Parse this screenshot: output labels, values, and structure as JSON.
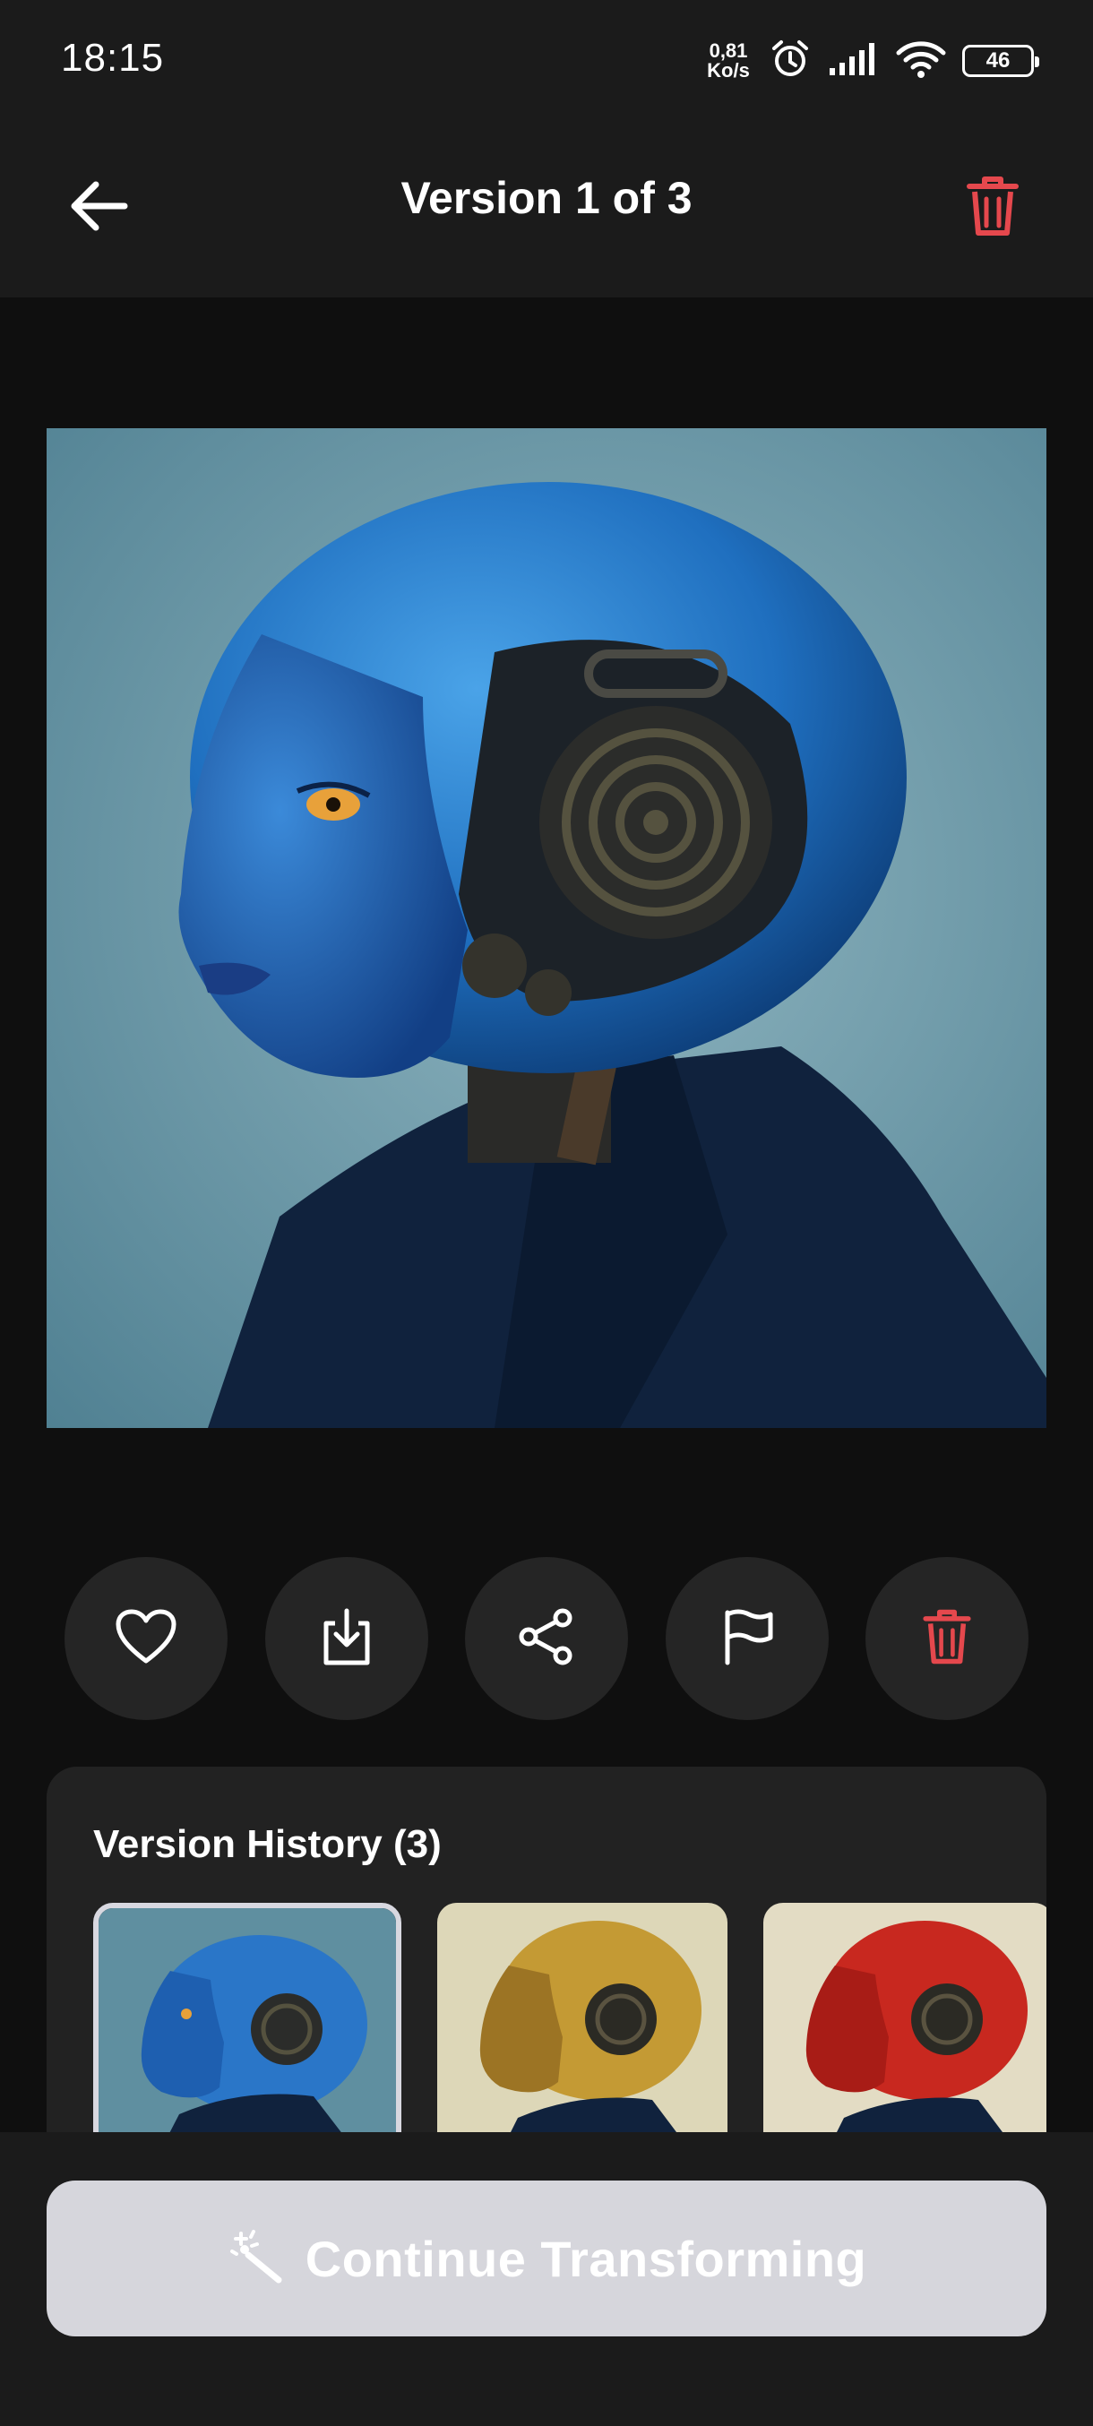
{
  "status_bar": {
    "time": "18:15",
    "net_speed_value": "0,81",
    "net_speed_unit": "Ko/s",
    "battery": "46",
    "icons": [
      "alarm-icon",
      "signal-icon",
      "wifi-icon",
      "battery-icon"
    ]
  },
  "header": {
    "title": "Version 1 of 3",
    "back_icon": "arrow-left-icon",
    "delete_icon": "trash-icon"
  },
  "main_image": {
    "description_icon": "image"
  },
  "actions": [
    {
      "name": "like",
      "icon": "heart-icon"
    },
    {
      "name": "download",
      "icon": "download-icon"
    },
    {
      "name": "share",
      "icon": "share-icon"
    },
    {
      "name": "report",
      "icon": "flag-icon"
    },
    {
      "name": "delete",
      "icon": "trash-icon"
    }
  ],
  "version_history": {
    "title": "Version History (3)",
    "items": [
      {
        "variant": "blue",
        "selected": true
      },
      {
        "variant": "gold",
        "selected": false
      },
      {
        "variant": "red",
        "selected": false
      }
    ]
  },
  "cta": {
    "label": "Continue Transforming",
    "icon": "magic-wand-icon"
  },
  "colors": {
    "danger": "#e5484d",
    "background": "#0f0f0f",
    "surface": "#1b1b1b",
    "card": "#222222",
    "button": "#252525",
    "cta_bg": "#d6d6dc"
  }
}
